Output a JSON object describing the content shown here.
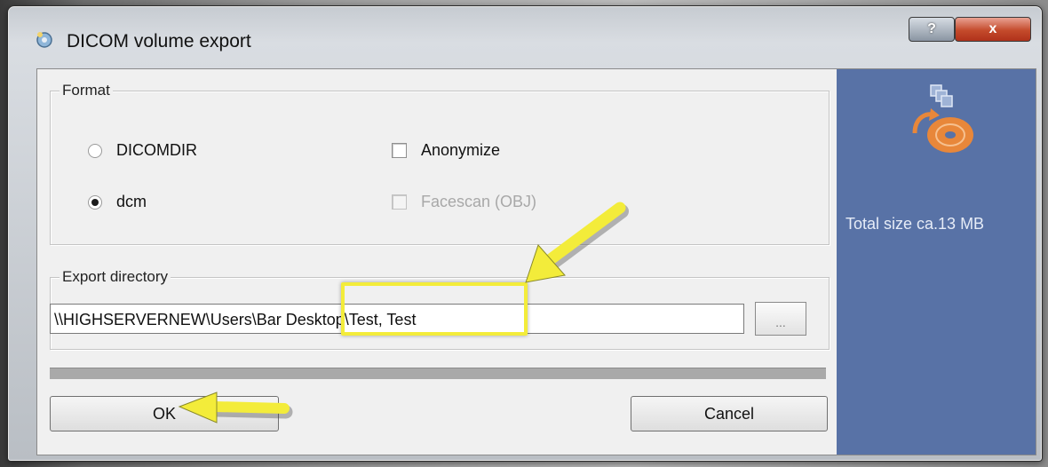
{
  "window": {
    "title": "DICOM volume export",
    "help_label": "?",
    "close_label": "x"
  },
  "format": {
    "legend": "Format",
    "options": [
      {
        "label": "DICOMDIR",
        "checked": false
      },
      {
        "label": "dcm",
        "checked": true
      }
    ],
    "anonymize_label": "Anonymize",
    "anonymize_checked": false,
    "facescan_label": "Facescan (OBJ)",
    "facescan_checked": false,
    "facescan_enabled": false
  },
  "export": {
    "legend": "Export directory",
    "path_value": "\\\\HIGHSERVERNEW\\Users\\Bar  Desktop\\Test, Test",
    "browse_label": "..."
  },
  "progress": {
    "value": 0
  },
  "buttons": {
    "ok_label": "OK",
    "cancel_label": "Cancel"
  },
  "side_panel": {
    "total_size": "Total size ca.13 MB",
    "icon": "disc-export-icon"
  },
  "colors": {
    "side_panel_bg": "#5872a6",
    "close_button": "#c44a2b",
    "annotation": "#f3ec3a",
    "icon_accent": "#e8873a"
  }
}
